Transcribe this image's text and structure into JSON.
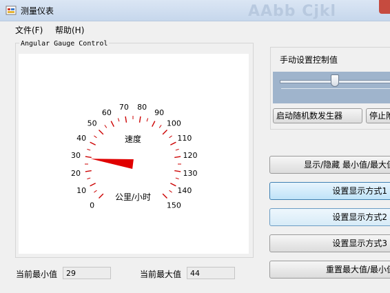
{
  "window": {
    "title": "测量仪表",
    "blurred_background_text": "AAbb Cjkl"
  },
  "menu": {
    "items": [
      {
        "label": "文件(F)"
      },
      {
        "label": "帮助(H)"
      }
    ]
  },
  "gauge": {
    "group_title": "Angular Gauge Control",
    "center_label": "速度",
    "unit_label": "公里/小时",
    "min": 0,
    "max": 150,
    "major_step": 10,
    "needle_value": 29,
    "needle_color": "#e00000",
    "tick_color": "#cc0000",
    "tick_labels": [
      "0",
      "10",
      "20",
      "30",
      "40",
      "50",
      "60",
      "70",
      "80",
      "90",
      "100",
      "110",
      "120",
      "130",
      "140",
      "150"
    ]
  },
  "manual": {
    "caption": "手动设置控制值",
    "slider_fraction": 0.47,
    "start_random_button": "启动随机数发生器",
    "stop_button": "停止附"
  },
  "buttons": {
    "toggle_minmax": "显示/隐藏 最小值/最大值",
    "mode1": "设置显示方式1",
    "mode2": "设置显示方式2",
    "mode3": "设置显示方式3",
    "reset_minmax": "重置最大值/最小值"
  },
  "status": {
    "current_min_label": "当前最小值",
    "current_min_value": "29",
    "current_max_label": "当前最大值",
    "current_max_value": "44"
  }
}
